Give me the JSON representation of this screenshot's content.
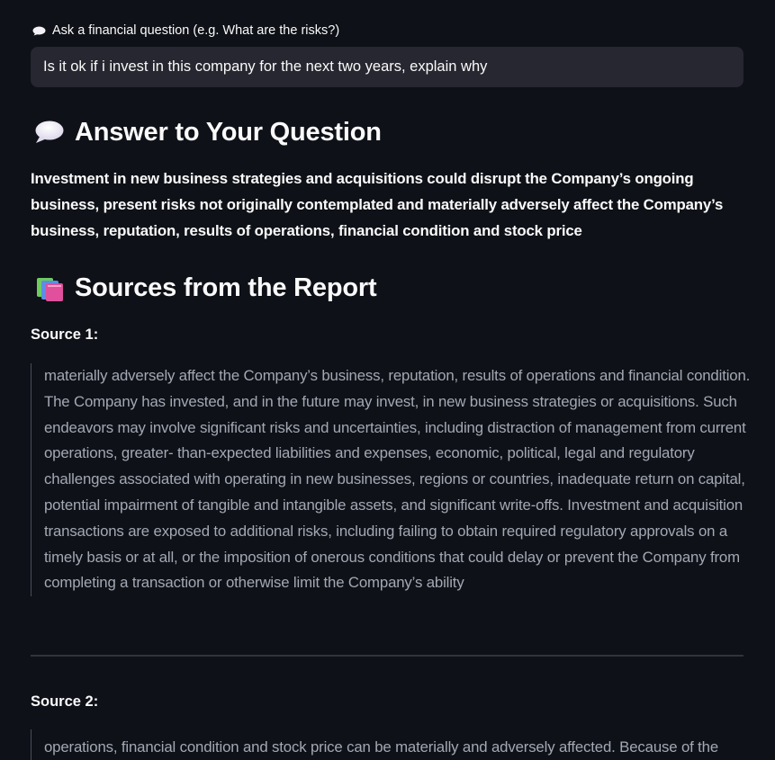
{
  "question_input": {
    "label": "Ask a financial question (e.g. What are the risks?)",
    "label_icon": "speech-balloon-icon",
    "value": "Is it ok if i invest in this company for the next two years, explain why"
  },
  "answer_section": {
    "heading": "Answer to Your Question",
    "heading_icon": "speech-balloon-icon",
    "text": "Investment in new business strategies and acquisitions could disrupt the Company’s ongoing business, present risks not originally contemplated and materially adversely affect the Company’s business, reputation, results of operations, financial condition and stock price"
  },
  "sources_section": {
    "heading": "Sources from the Report",
    "heading_icon": "books-icon",
    "sources": [
      {
        "label": "Source 1:",
        "text": "materially adversely affect the Company’s business, reputation, results of operations and financial condition. The Company has invested, and in the future may invest, in new business strategies or acquisitions. Such endeavors may involve significant risks and uncertainties, including distraction of management from current operations, greater- than-expected liabilities and expenses, economic, political, legal and regulatory challenges associated with operating in new businesses, regions or countries, inadequate return on capital, potential impairment of tangible and intangible assets, and significant write-offs. Investment and acquisition transactions are exposed to additional risks, including failing to obtain required regulatory approvals on a timely basis or at all, or the imposition of onerous conditions that could delay or prevent the Company from completing a transaction or otherwise limit the Company’s ability"
      },
      {
        "label": "Source 2:",
        "text": "operations, financial condition and stock price can be materially and adversely affected. Because of the"
      }
    ]
  },
  "colors": {
    "background": "#0e1117",
    "input_background": "#262730",
    "text": "#fafafa",
    "quote_text": "#a3a8b4",
    "quote_border": "#4a4d57",
    "divider": "#31333f"
  }
}
